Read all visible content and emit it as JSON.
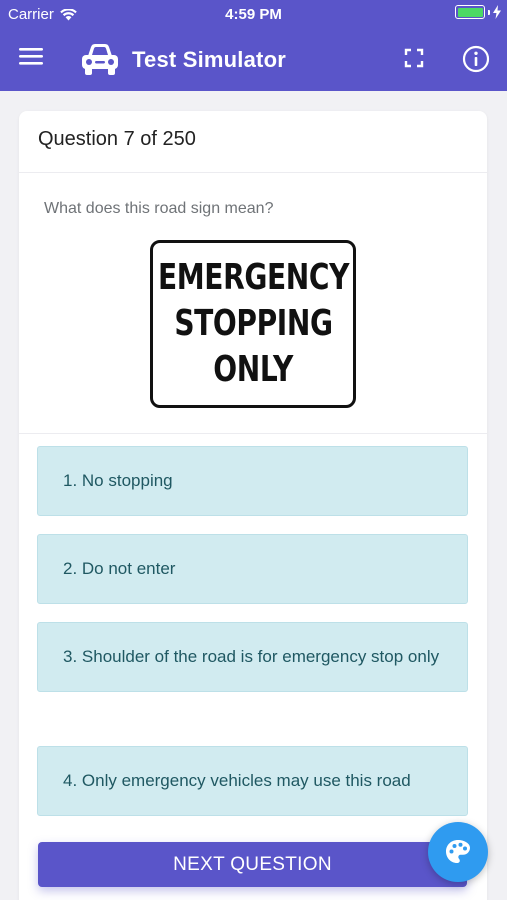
{
  "status_bar": {
    "carrier": "Carrier",
    "time": "4:59 PM",
    "battery_level": 1.0
  },
  "header": {
    "title": "Test Simulator",
    "background_color": "#5a55c9",
    "icons": [
      "menu-icon",
      "car-icon",
      "fullscreen-icon",
      "info-icon"
    ]
  },
  "question": {
    "counter": "Question 7 of 250",
    "text": "What does this road sign mean?",
    "sign_lines": [
      "EMERGENCY",
      "STOPPING",
      "ONLY"
    ]
  },
  "answers": [
    {
      "label": "1. No stopping"
    },
    {
      "label": "2. Do not enter"
    },
    {
      "label": "3. Shoulder of the road is for emergency stop only"
    },
    {
      "label": "4. Only emergency vehicles may use this road"
    }
  ],
  "next_button": {
    "label": "NEXT QUESTION"
  },
  "colors": {
    "accent": "#5a55c9",
    "answer_bg": "#d1ebf0",
    "answer_text": "#1f5862",
    "fab": "#2f9bf0"
  },
  "fab": {
    "icon": "palette-icon"
  }
}
